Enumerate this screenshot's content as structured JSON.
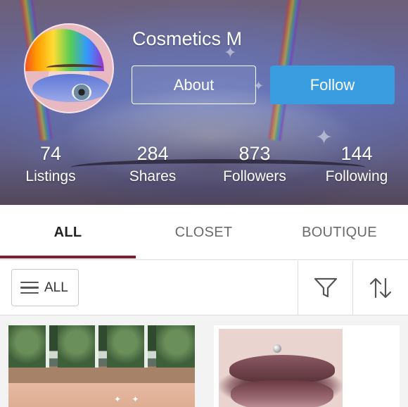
{
  "profile": {
    "name": "Cosmetics M",
    "about_label": "About",
    "follow_label": "Follow",
    "avatar_icon": "avatar-photo",
    "banner_icon": "cover-photo"
  },
  "stats": [
    {
      "value": "74",
      "label": "Listings"
    },
    {
      "value": "284",
      "label": "Shares"
    },
    {
      "value": "873",
      "label": "Followers"
    },
    {
      "value": "144",
      "label": "Following"
    }
  ],
  "tabs": [
    {
      "label": "ALL",
      "active": true
    },
    {
      "label": "CLOSET",
      "active": false
    },
    {
      "label": "BOUTIQUE",
      "active": false
    }
  ],
  "filterbar": {
    "all_label": "ALL",
    "menu_icon": "hamburger-icon",
    "filter_icon": "filter-icon",
    "sort_icon": "sort-icon"
  },
  "colors": {
    "follow_button": "#3a9de0",
    "tab_underline": "#7d2033",
    "active_tab_text": "#222222",
    "inactive_tab_text": "#6b6b6b"
  },
  "listings": [
    {
      "icon": "eyeshadow-palette-photo"
    },
    {
      "icon": "lip-gloss-photo"
    }
  ]
}
